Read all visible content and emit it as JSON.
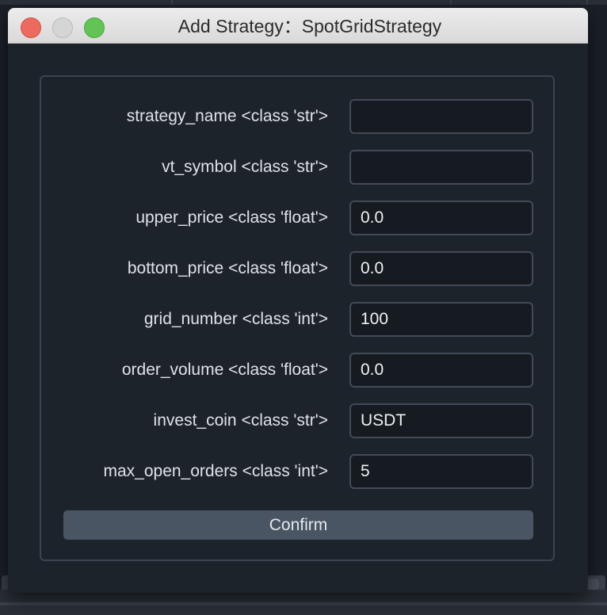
{
  "window": {
    "title": "Add Strategy：SpotGridStrategy"
  },
  "form": {
    "fields": [
      {
        "label": "strategy_name <class 'str'>",
        "value": ""
      },
      {
        "label": "vt_symbol <class 'str'>",
        "value": ""
      },
      {
        "label": "upper_price <class 'float'>",
        "value": "0.0"
      },
      {
        "label": "bottom_price <class 'float'>",
        "value": "0.0"
      },
      {
        "label": "grid_number <class 'int'>",
        "value": "100"
      },
      {
        "label": "order_volume <class 'float'>",
        "value": "0.0"
      },
      {
        "label": "invest_coin <class 'str'>",
        "value": "USDT"
      },
      {
        "label": "max_open_orders <class 'int'>",
        "value": "5"
      }
    ],
    "confirm_label": "Confirm"
  },
  "colors": {
    "background": "#1d232b",
    "input_border": "#414b57",
    "button": "#4a5563",
    "close": "#ed6a5e",
    "maximize": "#61c454"
  }
}
